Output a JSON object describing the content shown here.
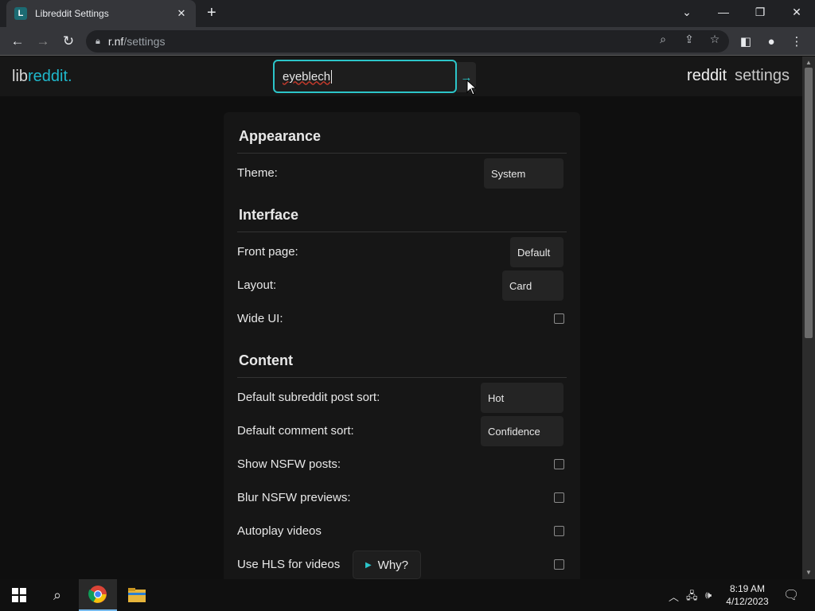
{
  "browser": {
    "tab_title": "Libreddit Settings",
    "tab_favicon_letter": "L",
    "url_host": "r.nf",
    "url_path": "/settings"
  },
  "page": {
    "logo_lib": "lib",
    "logo_reddit": "reddit.",
    "search_value": "eyeblech",
    "nav_reddit": "reddit",
    "nav_settings": "settings"
  },
  "settings": {
    "appearance_title": "Appearance",
    "theme_label": "Theme:",
    "theme_value": "System",
    "interface_title": "Interface",
    "front_page_label": "Front page:",
    "front_page_value": "Default",
    "layout_label": "Layout:",
    "layout_value": "Card",
    "wide_ui_label": "Wide UI:",
    "content_title": "Content",
    "post_sort_label": "Default subreddit post sort:",
    "post_sort_value": "Hot",
    "comment_sort_label": "Default comment sort:",
    "comment_sort_value": "Confidence",
    "show_nsfw_label": "Show NSFW posts:",
    "blur_nsfw_label": "Blur NSFW previews:",
    "autoplay_label": "Autoplay videos",
    "hls_label": "Use HLS for videos",
    "why_label": "Why?"
  },
  "taskbar": {
    "time": "8:19 AM",
    "date": "4/12/2023"
  },
  "colors": {
    "accent": "#2cc5c9",
    "background": "#0f0f0f",
    "panel": "#161616"
  }
}
